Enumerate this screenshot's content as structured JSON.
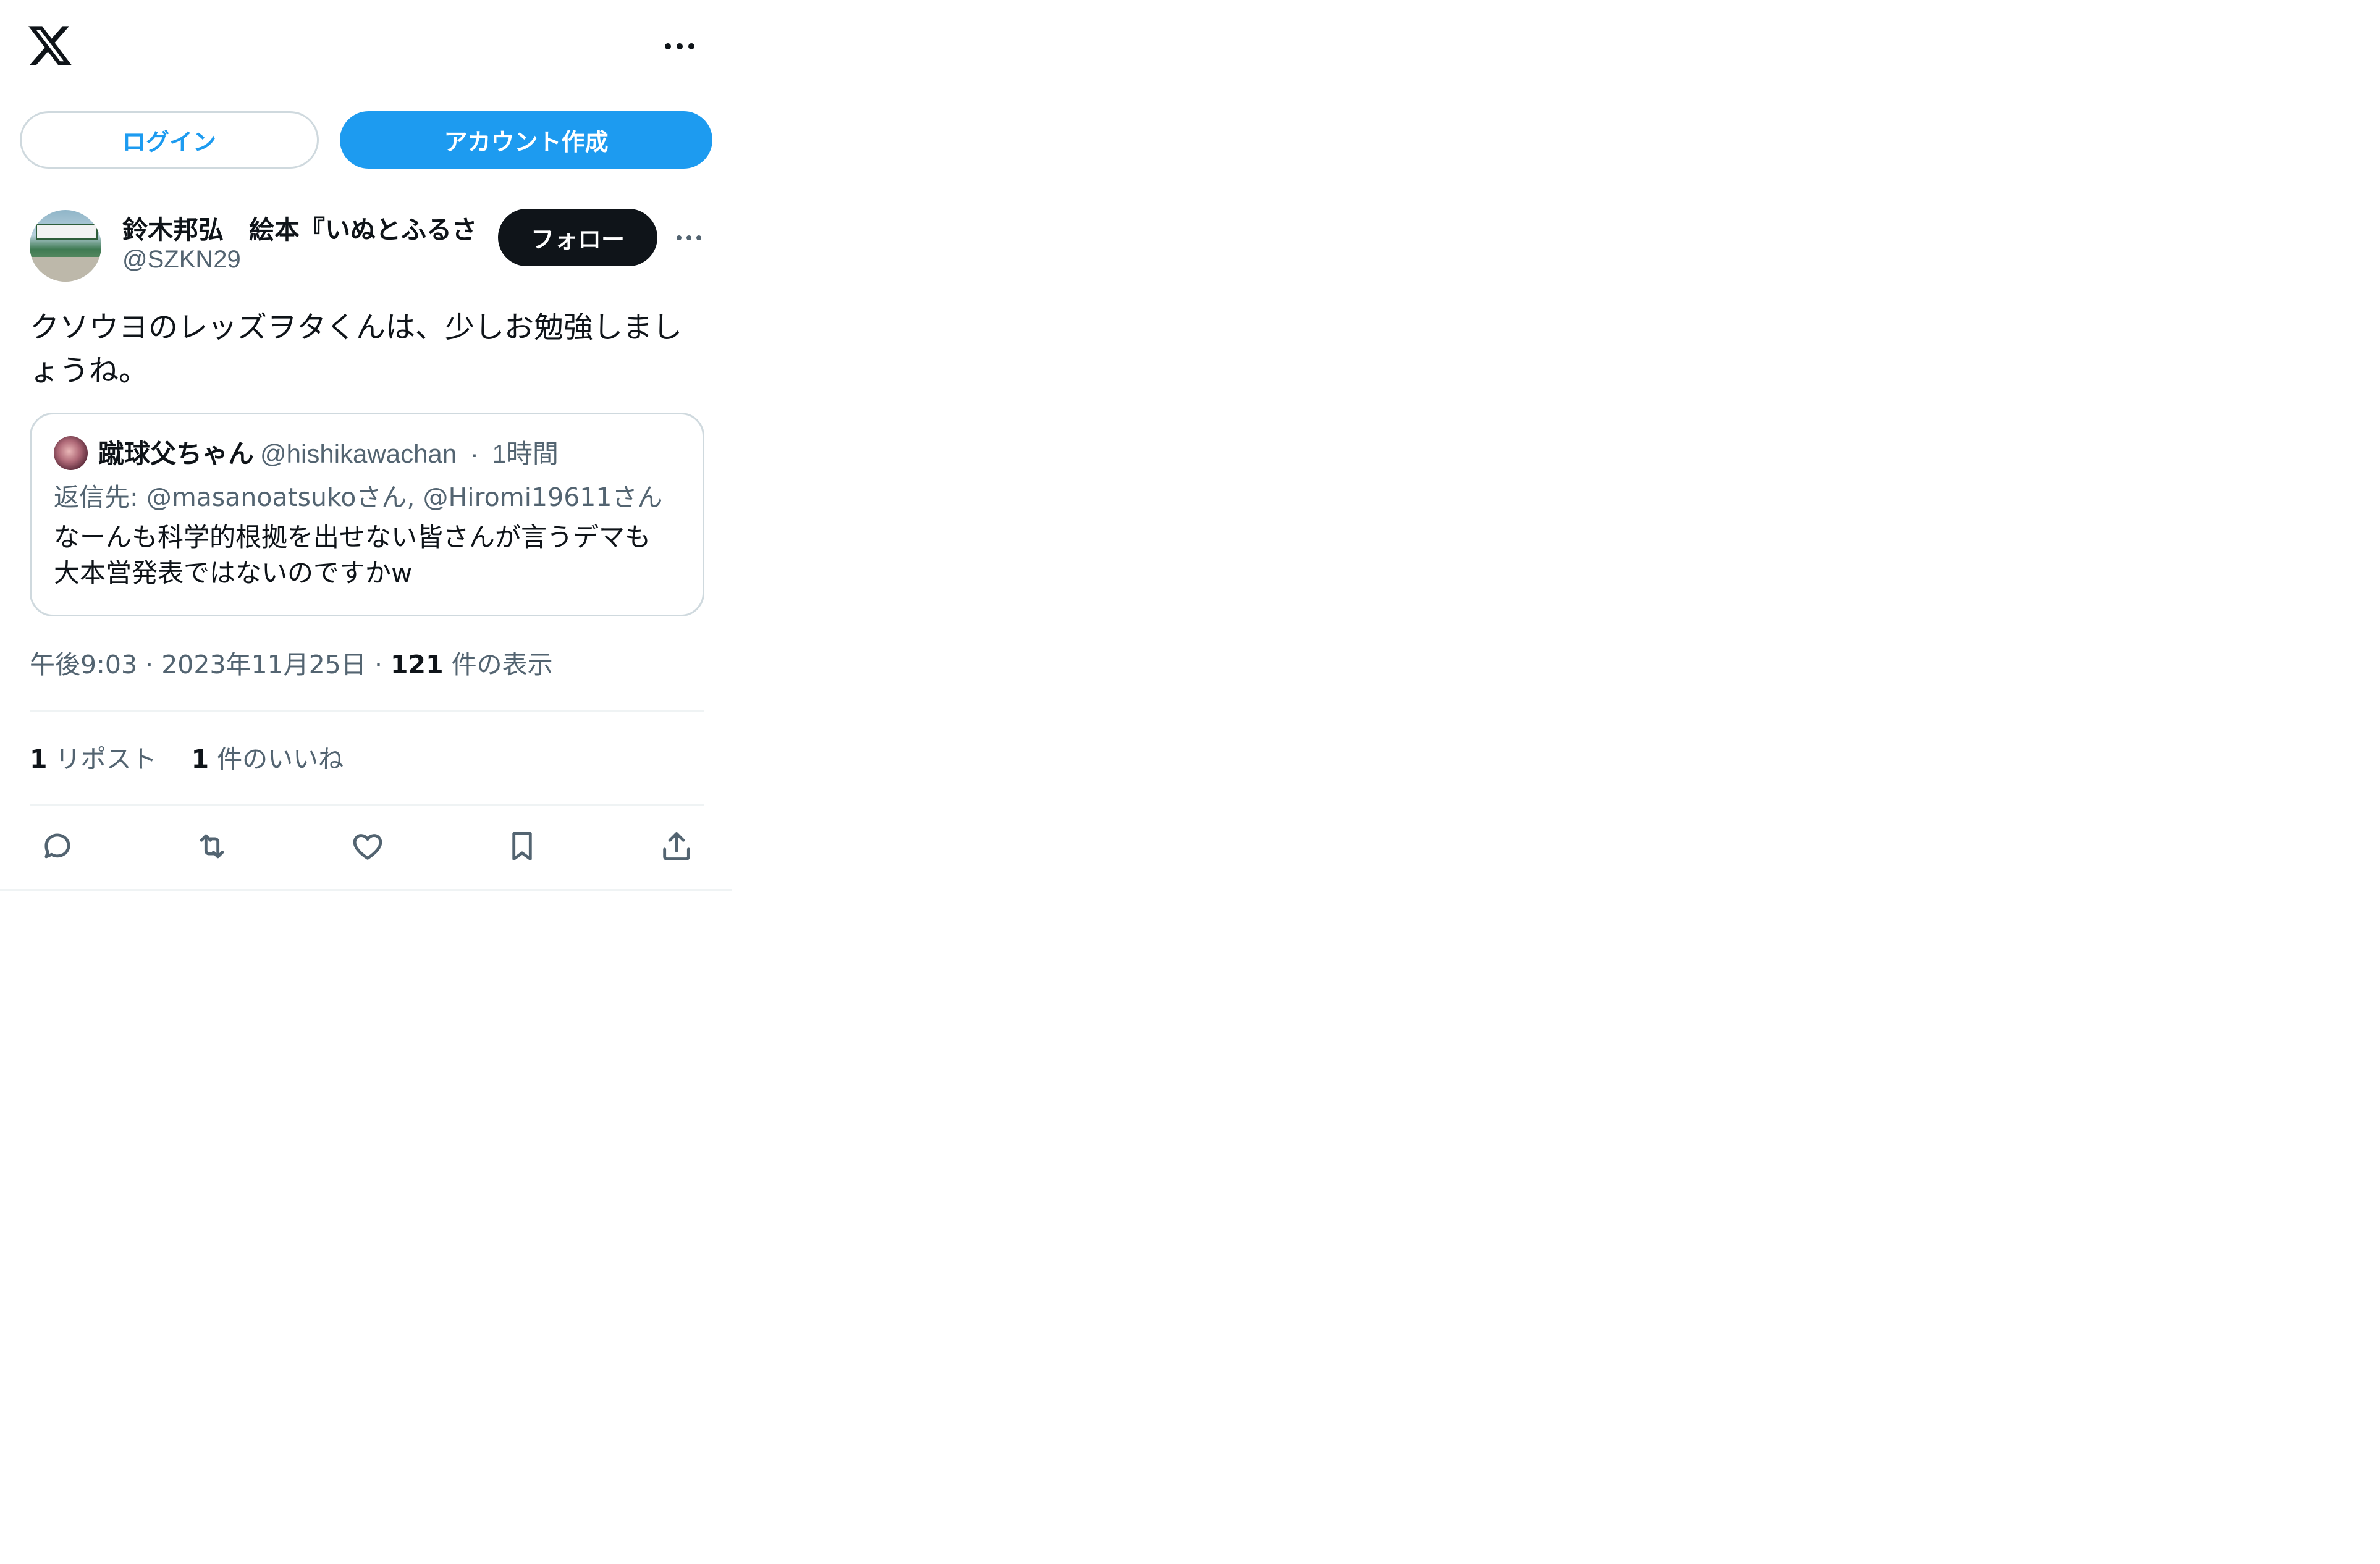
{
  "header": {
    "logo_icon": "x-logo-icon",
    "more_icon": "more-horizontal-icon"
  },
  "auth": {
    "login_label": "ログイン",
    "signup_label": "アカウント作成"
  },
  "tweet": {
    "author_name": "鈴木邦弘　絵本『いぬとふるさ",
    "author_handle": "@SZKN29",
    "follow_label": "フォロー",
    "text": "クソウヨのレッズヲタくんは、少しお勉強しまし\nょうね。",
    "time": "午後9:03",
    "date": "2023年11月25日",
    "views_count": "121",
    "views_label": "件の表示",
    "reposts_count": "1",
    "reposts_label": "リポスト",
    "likes_count": "1",
    "likes_label": "件のいいね"
  },
  "quoted_tweet": {
    "author_name": "蹴球父ちゃん",
    "author_handle": "@hishikawachan",
    "time": "1時間",
    "reply_prefix": "返信先: ",
    "reply_to": "@masanoatsukoさん, @Hiromi19611さん",
    "text": "なーんも科学的根拠を出せない皆さんが言うデマも\n大本営発表ではないのですかw"
  },
  "actions": {
    "icons": [
      "reply-icon",
      "repost-icon",
      "like-icon",
      "bookmark-icon",
      "share-icon"
    ]
  },
  "colors": {
    "accent": "#1d9bf0",
    "text_primary": "#0f1419",
    "text_secondary": "#536471",
    "border": "#cfd9de"
  }
}
